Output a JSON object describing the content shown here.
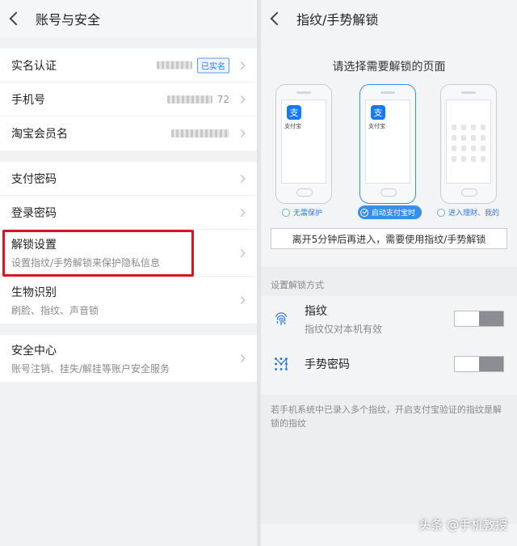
{
  "left": {
    "title": "账号与安全",
    "group1": [
      {
        "label": "实名认证",
        "badge": "已实名"
      },
      {
        "label": "手机号",
        "value_suffix": "72"
      },
      {
        "label": "淘宝会员名"
      }
    ],
    "group2": [
      {
        "label": "支付密码"
      },
      {
        "label": "登录密码"
      },
      {
        "label": "解锁设置",
        "sub": "设置指纹/手势解锁来保护隐私信息"
      },
      {
        "label": "生物识别",
        "sub": "刷脸、指纹、声音锁"
      }
    ],
    "group3": [
      {
        "label": "安全中心",
        "sub": "账号注销、挂失/解挂等账户安全服务"
      }
    ]
  },
  "right": {
    "title": "指纹/手势解锁",
    "choose_title": "请选择需要解锁的页面",
    "app_label": "支付宝",
    "app_glyph": "支",
    "radios": [
      "无需保护",
      "启动支付宝时",
      "进入理财、我的"
    ],
    "selected_radio": 1,
    "tip": "离开5分钟后再进入，需要使用指纹/手势解锁",
    "section": "设置解锁方式",
    "options": [
      {
        "label": "指纹",
        "sub": "指纹仅对本机有效",
        "icon": "fingerprint-icon",
        "enabled": false
      },
      {
        "label": "手势密码",
        "icon": "gesture-icon",
        "enabled": false
      }
    ],
    "note": "若手机系统中已录入多个指纹，开启支付宝验证的指纹是解锁的指纹"
  },
  "watermark": "头条 @手机教授",
  "colors": {
    "accent": "#2b7be0",
    "highlight": "#d9141c",
    "toggle_off": "#8a8d91"
  }
}
